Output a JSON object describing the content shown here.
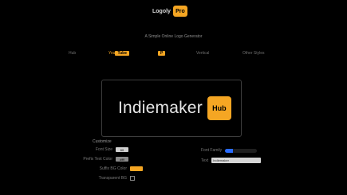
{
  "header": {
    "logo_text": "Logoly",
    "logo_box": "Pro"
  },
  "tagline": "A Simple Online Logo Generator",
  "nav": {
    "items": [
      {
        "label": "Hub"
      },
      {
        "label_prefix": "You",
        "label_highlight": "Tube"
      },
      {
        "label_highlight": "P"
      },
      {
        "label": "Vertical"
      },
      {
        "label": "Other Styles"
      }
    ]
  },
  "preview": {
    "text": "Indiemaker",
    "box_text": "Hub"
  },
  "controls": {
    "title": "Customize",
    "rows": [
      {
        "label": "Font Size",
        "value": "60"
      },
      {
        "label": "Prefix Text Color",
        "value": "#fff"
      },
      {
        "label": "Suffix BG Color",
        "value": ""
      },
      {
        "label": "Transparent BG",
        "value": ""
      }
    ]
  },
  "right": {
    "row1_label": "Font Family",
    "row2_label": "Text",
    "row2_value": "Indiemaker"
  },
  "colors": {
    "accent": "#f5a623",
    "background": "#000000"
  }
}
